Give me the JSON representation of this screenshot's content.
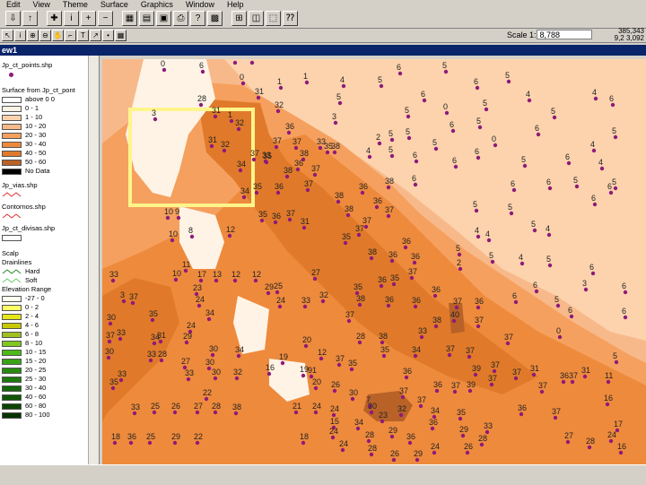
{
  "menubar": [
    "Edit",
    "View",
    "Theme",
    "Surface",
    "Graphics",
    "Window",
    "Help"
  ],
  "toolbar1_icons": [
    "save-icon",
    "arrow-icon",
    "cursor-icon",
    "identify-icon",
    "zoom-in-icon",
    "zoom-out-icon",
    "chart-icon",
    "table-icon",
    "layout-icon",
    "print-icon",
    "query-icon",
    "map-icon",
    "full-extent-icon",
    "zoom-previous-icon",
    "select-extent-icon",
    "help-icon"
  ],
  "toolbar2_icons": [
    "pointer-icon",
    "i-icon",
    "magnify-icon",
    "magnify-minus-icon",
    "hand-icon",
    "measure-icon",
    "text-icon",
    "hotlink-icon",
    "dot-icon",
    "grid-icon"
  ],
  "scale": {
    "label": "Scale 1:",
    "value": "8,788"
  },
  "coords": {
    "line1": "385,343",
    "line2": "9,2 3,092"
  },
  "window_title": "ew1",
  "toc": {
    "layer1": "Jp_ct_points.shp",
    "surface_title": "Surface from Jp_ct_pont",
    "surface_classes": [
      {
        "label": "above 0 0",
        "color": "#ffffff"
      },
      {
        "label": "0 - 1",
        "color": "#fff3e6"
      },
      {
        "label": "1 - 10",
        "color": "#fcd3ad"
      },
      {
        "label": "10 - 20",
        "color": "#f8b98a"
      },
      {
        "label": "20 - 30",
        "color": "#f5a05e"
      },
      {
        "label": "30 - 40",
        "color": "#ee8a3c"
      },
      {
        "label": "40 - 50",
        "color": "#e07a2a"
      },
      {
        "label": "50 - 60",
        "color": "#b86228"
      },
      {
        "label": "No Data",
        "color": "#000000"
      }
    ],
    "layer2": "Jp_vias.shp",
    "layer3": "Contornos.shp",
    "layer4": "Jp_ct_divisas.shp",
    "layer5": "Scalp",
    "drainage_title": "Drainlines",
    "drainage_items": [
      {
        "label": "Hard",
        "color": "#2a8a2a"
      },
      {
        "label": "Soft",
        "color": "#66cc66"
      }
    ],
    "elev_title": "Elevation Range",
    "elev_classes": [
      {
        "label": "-27 - 0",
        "color": "#ffffee"
      },
      {
        "label": "0 - 2",
        "color": "#ffff66"
      },
      {
        "label": "2 - 4",
        "color": "#e6e619"
      },
      {
        "label": "4 - 6",
        "color": "#c8c800"
      },
      {
        "label": "6 - 8",
        "color": "#a0c020"
      },
      {
        "label": "8 - 10",
        "color": "#80c820"
      },
      {
        "label": "10 - 15",
        "color": "#4cbb19"
      },
      {
        "label": "15 - 20",
        "color": "#3aa314"
      },
      {
        "label": "20 - 25",
        "color": "#2a8a10"
      },
      {
        "label": "25 - 30",
        "color": "#1e7a0c"
      },
      {
        "label": "30 - 40",
        "color": "#156608"
      },
      {
        "label": "40 - 60",
        "color": "#0f5506"
      },
      {
        "label": "60 - 80",
        "color": "#0a4404"
      },
      {
        "label": "80 - 100",
        "color": "#053302"
      }
    ]
  },
  "points": [
    [
      "28",
      262,
      70
    ],
    [
      "1",
      281,
      70
    ],
    [
      "0",
      183,
      78
    ],
    [
      "6",
      226,
      80
    ],
    [
      "1",
      342,
      92
    ],
    [
      "4",
      383,
      96
    ],
    [
      "6",
      446,
      82
    ],
    [
      "5",
      425,
      96
    ],
    [
      "5",
      497,
      80
    ],
    [
      "0",
      271,
      93
    ],
    [
      "1",
      313,
      98
    ],
    [
      "5",
      567,
      91
    ],
    [
      "6",
      532,
      98
    ],
    [
      "28",
      224,
      117
    ],
    [
      "31",
      288,
      109
    ],
    [
      "5",
      379,
      115
    ],
    [
      "6",
      473,
      112
    ],
    [
      "5",
      542,
      122
    ],
    [
      "4",
      590,
      112
    ],
    [
      "0",
      498,
      126
    ],
    [
      "3",
      173,
      133
    ],
    [
      "31",
      240,
      130
    ],
    [
      "1",
      258,
      135
    ],
    [
      "32",
      266,
      144
    ],
    [
      "32",
      310,
      124
    ],
    [
      "5",
      455,
      130
    ],
    [
      "5",
      618,
      131
    ],
    [
      "4",
      664,
      110
    ],
    [
      "6",
      683,
      117
    ],
    [
      "3",
      374,
      137
    ],
    [
      "31",
      236,
      163
    ],
    [
      "32",
      250,
      168
    ],
    [
      "37",
      308,
      164
    ],
    [
      "37",
      283,
      178
    ],
    [
      "33",
      296,
      180
    ],
    [
      "36",
      322,
      148
    ],
    [
      "37",
      330,
      165
    ],
    [
      "33",
      357,
      165
    ],
    [
      "35",
      365,
      170
    ],
    [
      "38",
      373,
      170
    ],
    [
      "2",
      423,
      160
    ],
    [
      "5",
      456,
      154
    ],
    [
      "5",
      437,
      156
    ],
    [
      "6",
      505,
      146
    ],
    [
      "5",
      535,
      142
    ],
    [
      "6",
      600,
      150
    ],
    [
      "5",
      686,
      153
    ],
    [
      "34",
      268,
      190
    ],
    [
      "35",
      297,
      181
    ],
    [
      "38",
      338,
      178
    ],
    [
      "36",
      332,
      189
    ],
    [
      "38",
      320,
      197
    ],
    [
      "37",
      351,
      195
    ],
    [
      "0",
      552,
      162
    ],
    [
      "5",
      486,
      166
    ],
    [
      "4",
      412,
      175
    ],
    [
      "5",
      437,
      174
    ],
    [
      "6",
      533,
      176
    ],
    [
      "4",
      662,
      168
    ],
    [
      "4",
      671,
      188
    ],
    [
      "35",
      286,
      215
    ],
    [
      "36",
      310,
      215
    ],
    [
      "37",
      343,
      212
    ],
    [
      "6",
      464,
      180
    ],
    [
      "6",
      508,
      186
    ],
    [
      "5",
      585,
      185
    ],
    [
      "6",
      634,
      182
    ],
    [
      "34",
      272,
      220
    ],
    [
      "36",
      404,
      215
    ],
    [
      "38",
      433,
      209
    ],
    [
      "6",
      463,
      206
    ],
    [
      "5",
      643,
      208
    ],
    [
      "6",
      681,
      215
    ],
    [
      "38",
      377,
      225
    ],
    [
      "36",
      420,
      231
    ],
    [
      "37",
      433,
      241
    ],
    [
      "6",
      573,
      212
    ],
    [
      "6",
      613,
      210
    ],
    [
      "5",
      686,
      210
    ],
    [
      "10",
      187,
      243
    ],
    [
      "9",
      199,
      243
    ],
    [
      "35",
      292,
      246
    ],
    [
      "36",
      307,
      248
    ],
    [
      "37",
      323,
      245
    ],
    [
      "38",
      388,
      240
    ],
    [
      "5",
      531,
      235
    ],
    [
      "5",
      570,
      238
    ],
    [
      "6",
      663,
      228
    ],
    [
      "31",
      339,
      254
    ],
    [
      "37",
      408,
      253
    ],
    [
      "37",
      400,
      262
    ],
    [
      "4",
      533,
      264
    ],
    [
      "5",
      596,
      257
    ],
    [
      "4",
      612,
      262
    ],
    [
      "10",
      192,
      268
    ],
    [
      "8",
      214,
      264
    ],
    [
      "12",
      256,
      263
    ],
    [
      "35",
      385,
      271
    ],
    [
      "36",
      452,
      276
    ],
    [
      "4",
      545,
      268
    ],
    [
      "5",
      512,
      284
    ],
    [
      "5",
      549,
      292
    ],
    [
      "4",
      582,
      294
    ],
    [
      "11",
      207,
      302
    ],
    [
      "38",
      414,
      288
    ],
    [
      "36",
      437,
      291
    ],
    [
      "36",
      462,
      293
    ],
    [
      "2",
      513,
      300
    ],
    [
      "5",
      613,
      296
    ],
    [
      "6",
      661,
      305
    ],
    [
      "33",
      126,
      313
    ],
    [
      "10",
      196,
      312
    ],
    [
      "17",
      224,
      313
    ],
    [
      "13",
      241,
      313
    ],
    [
      "12",
      262,
      313
    ],
    [
      "12",
      285,
      313
    ],
    [
      "27",
      351,
      311
    ],
    [
      "36",
      425,
      319
    ],
    [
      "35",
      439,
      317
    ],
    [
      "37",
      459,
      310
    ],
    [
      "6",
      598,
      325
    ],
    [
      "3",
      653,
      323
    ],
    [
      "23",
      219,
      328
    ],
    [
      "25",
      309,
      326
    ],
    [
      "29",
      299,
      327
    ],
    [
      "35",
      398,
      327
    ],
    [
      "36",
      485,
      330
    ],
    [
      "6",
      575,
      337
    ],
    [
      "5",
      622,
      341
    ],
    [
      "6",
      697,
      326
    ],
    [
      "3",
      138,
      336
    ],
    [
      "37",
      148,
      338
    ],
    [
      "24",
      222,
      341
    ],
    [
      "24",
      312,
      342
    ],
    [
      "33",
      340,
      342
    ],
    [
      "32",
      360,
      336
    ],
    [
      "38",
      401,
      340
    ],
    [
      "36",
      433,
      341
    ],
    [
      "36",
      463,
      342
    ],
    [
      "37",
      509,
      343
    ],
    [
      "36",
      533,
      343
    ],
    [
      "30",
      123,
      361
    ],
    [
      "35",
      170,
      357
    ],
    [
      "34",
      233,
      356
    ],
    [
      "37",
      389,
      358
    ],
    [
      "40",
      506,
      358
    ],
    [
      "6",
      637,
      353
    ],
    [
      "6",
      697,
      354
    ],
    [
      "24",
      212,
      370
    ],
    [
      "38",
      486,
      364
    ],
    [
      "37",
      533,
      364
    ],
    [
      "0",
      624,
      376
    ],
    [
      "33",
      134,
      378
    ],
    [
      "37",
      122,
      381
    ],
    [
      "34",
      172,
      383
    ],
    [
      "31",
      179,
      381
    ],
    [
      "29",
      208,
      382
    ],
    [
      "28",
      401,
      382
    ],
    [
      "38",
      426,
      382
    ],
    [
      "33",
      470,
      376
    ],
    [
      "37",
      566,
      383
    ],
    [
      "30",
      121,
      399
    ],
    [
      "20",
      341,
      386
    ],
    [
      "30",
      237,
      396
    ],
    [
      "34",
      266,
      397
    ],
    [
      "35",
      428,
      397
    ],
    [
      "34",
      463,
      397
    ],
    [
      "37",
      501,
      396
    ],
    [
      "37",
      523,
      398
    ],
    [
      "5",
      687,
      404
    ],
    [
      "33",
      168,
      402
    ],
    [
      "28",
      180,
      402
    ],
    [
      "19",
      315,
      405
    ],
    [
      "12",
      358,
      400
    ],
    [
      "37",
      378,
      407
    ],
    [
      "27",
      206,
      410
    ],
    [
      "30",
      233,
      411
    ],
    [
      "16",
      300,
      417
    ],
    [
      "19",
      338,
      419
    ],
    [
      "91",
      347,
      420
    ],
    [
      "35",
      392,
      412
    ],
    [
      "36",
      453,
      421
    ],
    [
      "39",
      530,
      418
    ],
    [
      "37",
      551,
      414
    ],
    [
      "33",
      135,
      424
    ],
    [
      "33",
      210,
      423
    ],
    [
      "30",
      240,
      422
    ],
    [
      "32",
      264,
      422
    ],
    [
      "35",
      126,
      433
    ],
    [
      "31",
      595,
      418
    ],
    [
      "31",
      652,
      420
    ],
    [
      "36",
      628,
      426
    ],
    [
      "37",
      638,
      426
    ],
    [
      "11",
      678,
      426
    ],
    [
      "37",
      575,
      422
    ],
    [
      "20",
      352,
      433
    ],
    [
      "26",
      373,
      436
    ],
    [
      "37",
      507,
      437
    ],
    [
      "39",
      524,
      436
    ],
    [
      "37",
      604,
      437
    ],
    [
      "37",
      548,
      429
    ],
    [
      "22",
      230,
      445
    ],
    [
      "36",
      487,
      436
    ],
    [
      "37",
      449,
      443
    ],
    [
      "30",
      393,
      445
    ],
    [
      "7",
      412,
      453
    ],
    [
      "37",
      469,
      453
    ],
    [
      "16",
      677,
      451
    ],
    [
      "33",
      150,
      461
    ],
    [
      "25",
      172,
      460
    ],
    [
      "26",
      195,
      460
    ],
    [
      "27",
      220,
      460
    ],
    [
      "28",
      240,
      460
    ],
    [
      "38",
      263,
      461
    ],
    [
      "21",
      330,
      460
    ],
    [
      "24",
      352,
      460
    ],
    [
      "24",
      372,
      463
    ],
    [
      "30",
      414,
      460
    ],
    [
      "32",
      447,
      463
    ],
    [
      "34",
      484,
      465
    ],
    [
      "35",
      513,
      467
    ],
    [
      "36",
      581,
      462
    ],
    [
      "37",
      619,
      466
    ],
    [
      "23",
      426,
      470
    ],
    [
      "17",
      688,
      480
    ],
    [
      "33",
      543,
      482
    ],
    [
      "36",
      482,
      478
    ],
    [
      "15",
      372,
      477
    ],
    [
      "34",
      399,
      478
    ],
    [
      "29",
      516,
      486
    ],
    [
      "24",
      371,
      488
    ],
    [
      "28",
      411,
      492
    ],
    [
      "29",
      437,
      487
    ],
    [
      "36",
      457,
      494
    ],
    [
      "36",
      146,
      494
    ],
    [
      "18",
      128,
      494
    ],
    [
      "29",
      195,
      494
    ],
    [
      "22",
      220,
      494
    ],
    [
      "25",
      167,
      494
    ],
    [
      "18",
      338,
      494
    ],
    [
      "24",
      382,
      502
    ],
    [
      "28",
      537,
      496
    ],
    [
      "24",
      484,
      505
    ],
    [
      "26",
      521,
      505
    ],
    [
      "27",
      633,
      493
    ],
    [
      "28",
      657,
      499
    ],
    [
      "24",
      681,
      492
    ],
    [
      "26",
      439,
      513
    ],
    [
      "29",
      465,
      513
    ],
    [
      "16",
      692,
      505
    ],
    [
      "28",
      414,
      507
    ]
  ]
}
